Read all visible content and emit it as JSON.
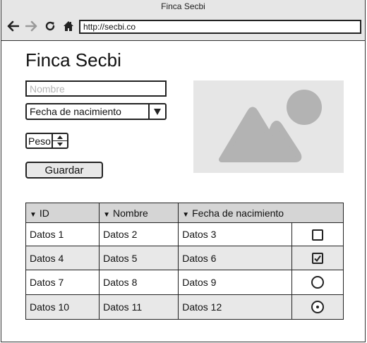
{
  "window": {
    "title": "Finca Secbi"
  },
  "browser": {
    "url": "http://secbi.co",
    "icons": [
      "back-arrow-icon",
      "forward-arrow-icon",
      "reload-icon",
      "home-icon"
    ]
  },
  "page": {
    "title": "Finca Secbi",
    "form": {
      "name_placeholder": "Nombre",
      "birthdate_select": "Fecha de nacimiento",
      "weight_label": "Peso",
      "save_label": "Guardar"
    },
    "image": {
      "icon": "image-placeholder-icon"
    },
    "table": {
      "columns": [
        "ID",
        "Nombre",
        "Fecha de nacimiento"
      ],
      "rows": [
        {
          "cells": [
            "Datos 1",
            "Datos 2",
            "Datos 3"
          ],
          "control": "checkbox",
          "checked": false
        },
        {
          "cells": [
            "Datos 4",
            "Datos 5",
            "Datos 6"
          ],
          "control": "checkbox",
          "checked": true
        },
        {
          "cells": [
            "Datos 7",
            "Datos 8",
            "Datos 9"
          ],
          "control": "radio",
          "checked": false
        },
        {
          "cells": [
            "Datos 10",
            "Datos 11",
            "Datos 12"
          ],
          "control": "radio",
          "checked": true
        }
      ]
    }
  },
  "colors": {
    "chrome": "#e6e6e6",
    "border": "#222222",
    "header_bg": "#d5d5d5",
    "row_alt": "#e8e8e8",
    "placeholder_image_bg": "#e6e6e6",
    "placeholder_image_fg": "#b3b3b3"
  }
}
